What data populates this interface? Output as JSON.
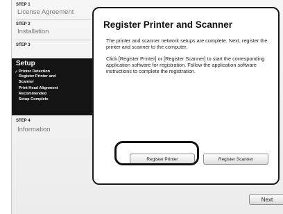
{
  "sidebar": {
    "steps": [
      {
        "label": "STEP 1",
        "title": "License Agreement"
      },
      {
        "label": "STEP 2",
        "title": "Installation"
      },
      {
        "label": "STEP 3",
        "title": "Setup",
        "substeps": [
          "Printer Detection",
          "Register Printer and",
          "Scanner",
          "Print Head Alignment",
          "Recommended",
          "Setup Complete"
        ],
        "check": "✓"
      },
      {
        "label": "STEP 4",
        "title": "Information"
      }
    ]
  },
  "main": {
    "title": "Register Printer and Scanner",
    "paragraph1": "The printer and scanner network setups are complete. Next, register the printer and scanner to the computer.",
    "paragraph2": "Click [Register Printer] or [Register Scanner] to start the corresponding application software for registration. Follow the application software instructions to complete the registration.",
    "register_printer_label": "Register Printer",
    "register_scanner_label": "Register Scanner"
  },
  "footer": {
    "next_label": "Next"
  }
}
